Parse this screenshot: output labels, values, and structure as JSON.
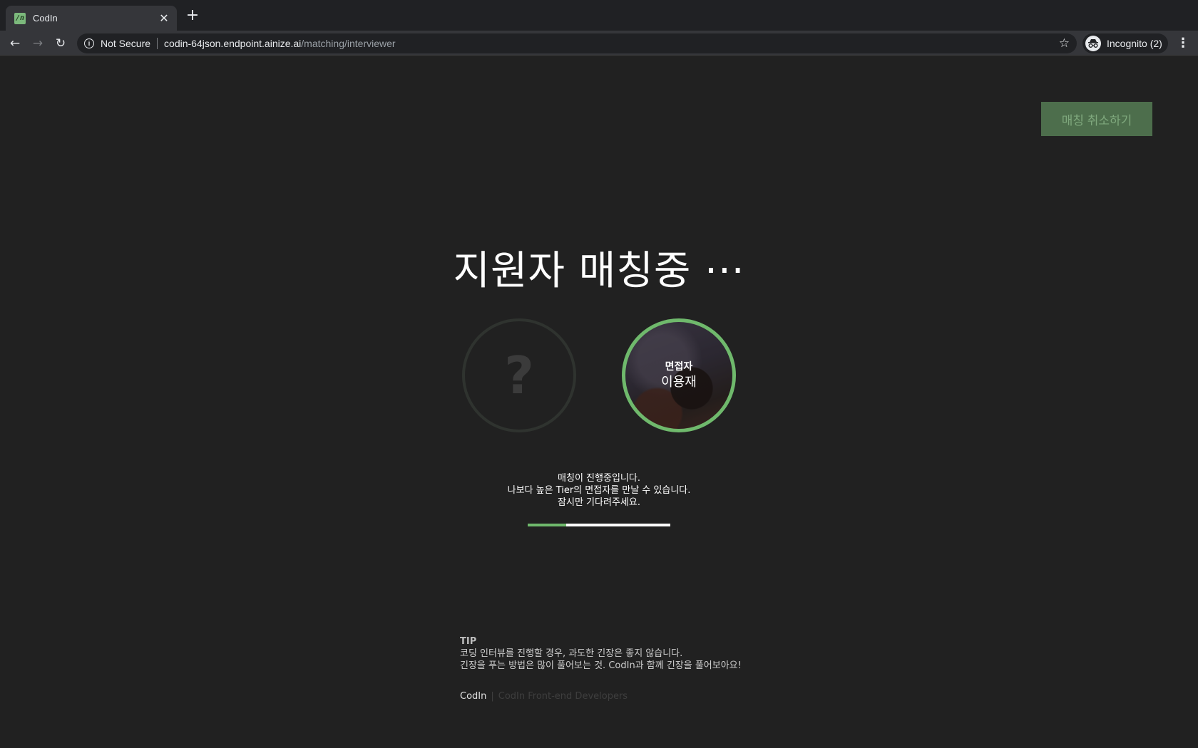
{
  "browser": {
    "tab_title": "CodIn",
    "favicon_text": "/n",
    "security_label": "Not Secure",
    "url_host": "codin-64json.endpoint.ainize.ai",
    "url_path": "/matching/interviewer",
    "profile_label": "Incognito (2)"
  },
  "header": {
    "cancel_label": "매칭 취소하기"
  },
  "main": {
    "title": "지원자 매칭중 ···",
    "unknown_placeholder": "?",
    "interviewer_role": "면접자",
    "interviewer_name": "이용재",
    "message_line1": "매칭이 진행중입니다.",
    "message_line2": "나보다 높은 Tier의 면접자를 만날 수 있습니다.",
    "message_line3": "잠시만 기다려주세요.",
    "progress": 0.27
  },
  "tip": {
    "title": "TIP",
    "line1": "코딩 인터뷰를 진행할 경우, 과도한 긴장은 좋지 않습니다.",
    "line2": "긴장을 푸는 방법은 많이 풀어보는 것. CodIn과 함께 긴장을 풀어보아요!"
  },
  "footer": {
    "brand": "CodIn",
    "separator": "|",
    "subtitle": "CodIn Front-end Developers"
  },
  "colors": {
    "accent_green": "#6fb96c",
    "cancel_bg": "#4d6e4c",
    "page_bg": "#212121"
  },
  "icons": [
    "back-icon",
    "forward-icon",
    "reload-icon",
    "info-icon",
    "star-icon",
    "incognito-icon",
    "menu-icon",
    "close-icon",
    "plus-icon"
  ]
}
